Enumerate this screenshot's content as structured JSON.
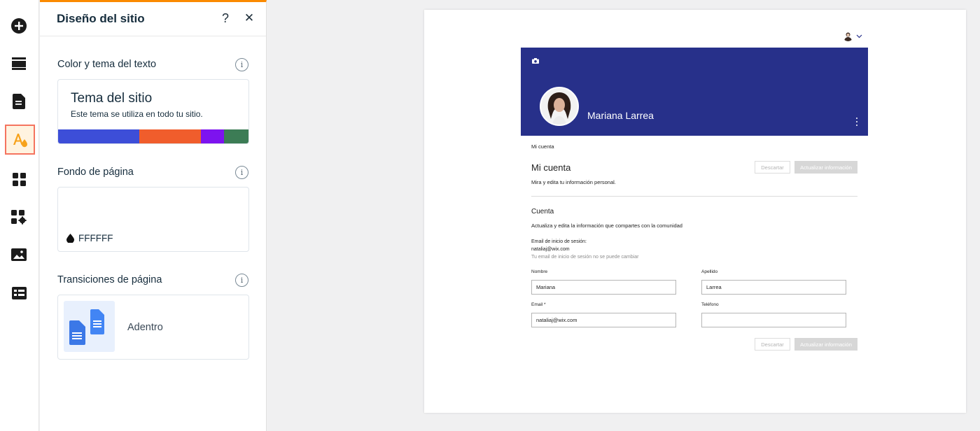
{
  "rail": {
    "items": [
      {
        "name": "add",
        "icon": "plus-circle-icon"
      },
      {
        "name": "menus",
        "icon": "menus-pages-icon"
      },
      {
        "name": "pages",
        "icon": "page-icon"
      },
      {
        "name": "site-design",
        "icon": "theme-design-icon",
        "active": true
      },
      {
        "name": "apps",
        "icon": "apps-grid-icon"
      },
      {
        "name": "business",
        "icon": "puzzle-gear-icon"
      },
      {
        "name": "media",
        "icon": "image-icon"
      },
      {
        "name": "cms",
        "icon": "table-icon"
      }
    ]
  },
  "panel": {
    "title": "Diseño del sitio",
    "help_label": "?",
    "close_label": "✕",
    "text_theme": {
      "title": "Color y tema del texto",
      "card_title": "Tema del sitio",
      "card_desc": "Este tema se utiliza en todo tu sitio.",
      "colors": [
        "#3d4ed8",
        "#f05d2c",
        "#7d13ef",
        "#3c7c55"
      ]
    },
    "page_bg": {
      "title": "Fondo de página",
      "value": "FFFFFF"
    },
    "transitions": {
      "title": "Transiciones de página",
      "value": "Adentro"
    },
    "info_label": "i"
  },
  "site": {
    "banner_color": "#27308a",
    "user_name": "Mariana Larrea",
    "breadcrumb": "Mi cuenta",
    "heading": "Mi cuenta",
    "subheading": "Mira y edita tu información personal.",
    "discard_label": "Descartar",
    "update_label": "Actualizar información",
    "section_title": "Cuenta",
    "section_desc": "Actualiza y edita la información que compartes con la comunidad",
    "login_email_label": "Email de inicio de sesión:",
    "login_email_value": "nataliaj@wix.com",
    "login_email_hint": "Tu email de inicio de sesión no se puede cambiar",
    "first_name_label": "Nombre",
    "first_name_value": "Mariana",
    "last_name_label": "Apellido",
    "last_name_value": "Larrea",
    "email_label": "Email *",
    "email_value": "nataliaj@wix.com",
    "phone_label": "Teléfono",
    "phone_value": ""
  }
}
